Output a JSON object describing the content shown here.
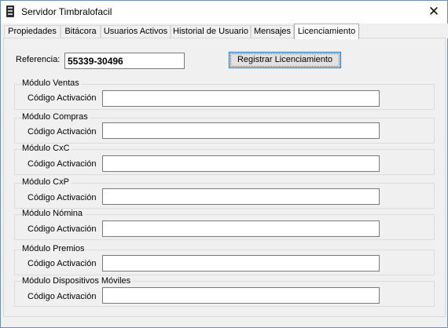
{
  "window": {
    "title": "Servidor Timbralofacil",
    "close_glyph": "✕"
  },
  "tabs": [
    {
      "label": "Propiedades",
      "active": false
    },
    {
      "label": "Bitácora",
      "active": false
    },
    {
      "label": "Usuarios Activos",
      "active": false
    },
    {
      "label": "Historial de Usuario",
      "active": false
    },
    {
      "label": "Mensajes",
      "active": false
    },
    {
      "label": "Licenciamiento",
      "active": true
    }
  ],
  "reference": {
    "label": "Referencia:",
    "value": "55339-30496"
  },
  "register_button": {
    "label": "Registrar Licenciamiento"
  },
  "modules": [
    {
      "title": "Módulo Ventas",
      "code_label": "Código Activación",
      "code_value": ""
    },
    {
      "title": "Módulo Compras",
      "code_label": "Código Activación",
      "code_value": ""
    },
    {
      "title": "Módulo CxC",
      "code_label": "Código Activación",
      "code_value": ""
    },
    {
      "title": "Módulo CxP",
      "code_label": "Código Activación",
      "code_value": ""
    },
    {
      "title": "Módulo Nómina",
      "code_label": "Código Activación",
      "code_value": ""
    },
    {
      "title": "Módulo Premios",
      "code_label": "Código Activación",
      "code_value": ""
    },
    {
      "title": "Módulo Dispositivos Móviles",
      "code_label": "Código Activación",
      "code_value": ""
    }
  ],
  "icons": {
    "app": "server-app-icon",
    "close": "close-icon"
  }
}
